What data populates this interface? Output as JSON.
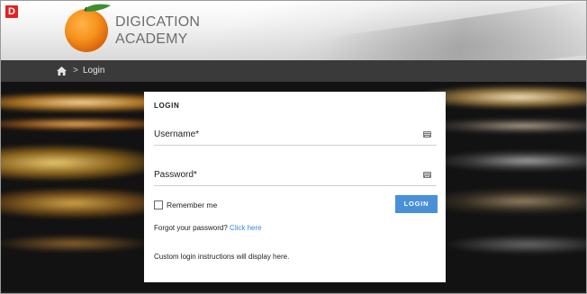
{
  "badge": {
    "letter": "D",
    "color": "#e5201f"
  },
  "brand": {
    "line1": "DIGICATION",
    "line2": "ACADEMY",
    "logo_icon": "orange-fruit-icon"
  },
  "breadcrumb": {
    "home_icon": "home-icon",
    "separator": ">",
    "current": "Login"
  },
  "login": {
    "title": "LOGIN",
    "username_label": "Username*",
    "password_label": "Password*",
    "field_icon": "keyboard-icon",
    "remember_label": "Remember me",
    "remember_checked": false,
    "button_label": "LOGIN",
    "forgot_text": "Forgot your password?",
    "forgot_link": "Click here",
    "instructions": "Custom login instructions will display here.",
    "accent_color": "#4a90d9"
  }
}
